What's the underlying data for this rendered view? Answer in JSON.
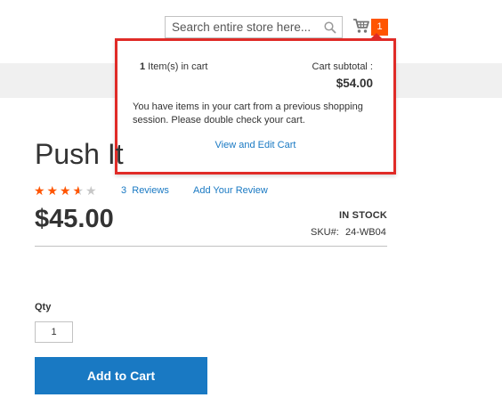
{
  "header": {
    "search": {
      "placeholder": "Search entire store here...",
      "value": ""
    },
    "cart_counter": "1"
  },
  "minicart": {
    "items_count": "1",
    "items_label": " Item(s) in cart",
    "subtotal_label": "Cart subtotal :",
    "subtotal_value": "$54.00",
    "message": "You have items in your cart from a previous shopping session. Please double check your cart.",
    "view_cart_link": "View and Edit Cart"
  },
  "product": {
    "title": "Push It",
    "rating": {
      "value": 3.5,
      "max": 5,
      "filled_color": "#ff5501",
      "empty_color": "#c7c7c7"
    },
    "reviews_count": "3",
    "reviews_label": "Reviews",
    "add_review": "Add Your Review",
    "price": "$45.00",
    "stock": "IN STOCK",
    "sku_label": "SKU#:",
    "sku_value": "24-WB04",
    "qty_label": "Qty",
    "qty_value": "1",
    "add_to_cart": "Add to Cart"
  },
  "colors": {
    "accent": "#1979c3",
    "badge": "#ff5501",
    "highlight_border": "#e02b27"
  },
  "icons": [
    "search-icon",
    "cart-icon",
    "star-icon"
  ]
}
